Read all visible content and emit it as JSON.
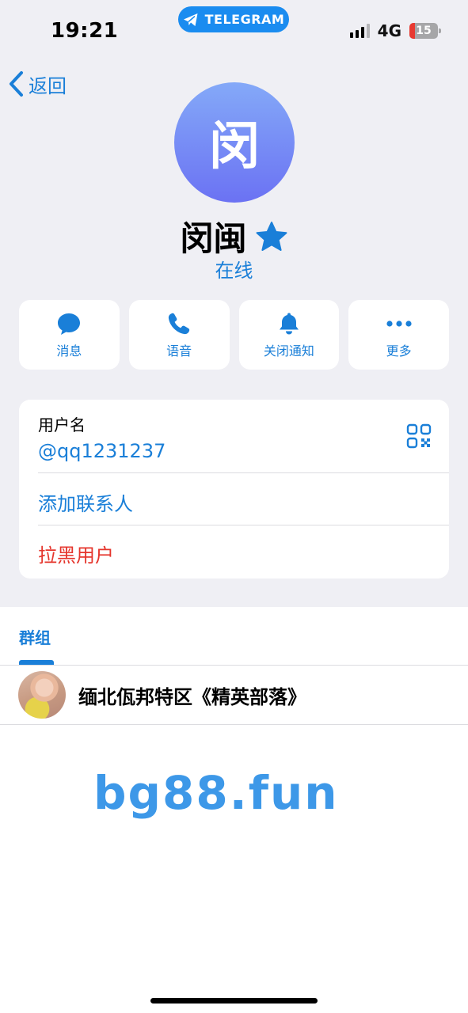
{
  "status_bar": {
    "time": "19:21",
    "app_pill": "TELEGRAM",
    "network": "4G",
    "battery": "15"
  },
  "nav": {
    "back_label": "返回"
  },
  "profile": {
    "avatar_char": "闵",
    "name": "闵闽",
    "status": "在线",
    "avatar_gradient": [
      "#84a9f8",
      "#6b72f3"
    ]
  },
  "actions": [
    {
      "label": "消息",
      "icon": "message-icon"
    },
    {
      "label": "语音",
      "icon": "phone-icon"
    },
    {
      "label": "关闭通知",
      "icon": "bell-icon"
    },
    {
      "label": "更多",
      "icon": "more-icon"
    }
  ],
  "info": {
    "username_label": "用户名",
    "username": "@qq1231237",
    "add_contact": "添加联系人",
    "block_user": "拉黑用户"
  },
  "groups": {
    "tab_label": "群组",
    "items": [
      {
        "name": "缅北佤邦特区《精英部落》"
      }
    ]
  },
  "watermark": "bg88.fun",
  "colors": {
    "accent": "#1a7fd8",
    "danger": "#e5352c",
    "background": "#efeff4"
  }
}
